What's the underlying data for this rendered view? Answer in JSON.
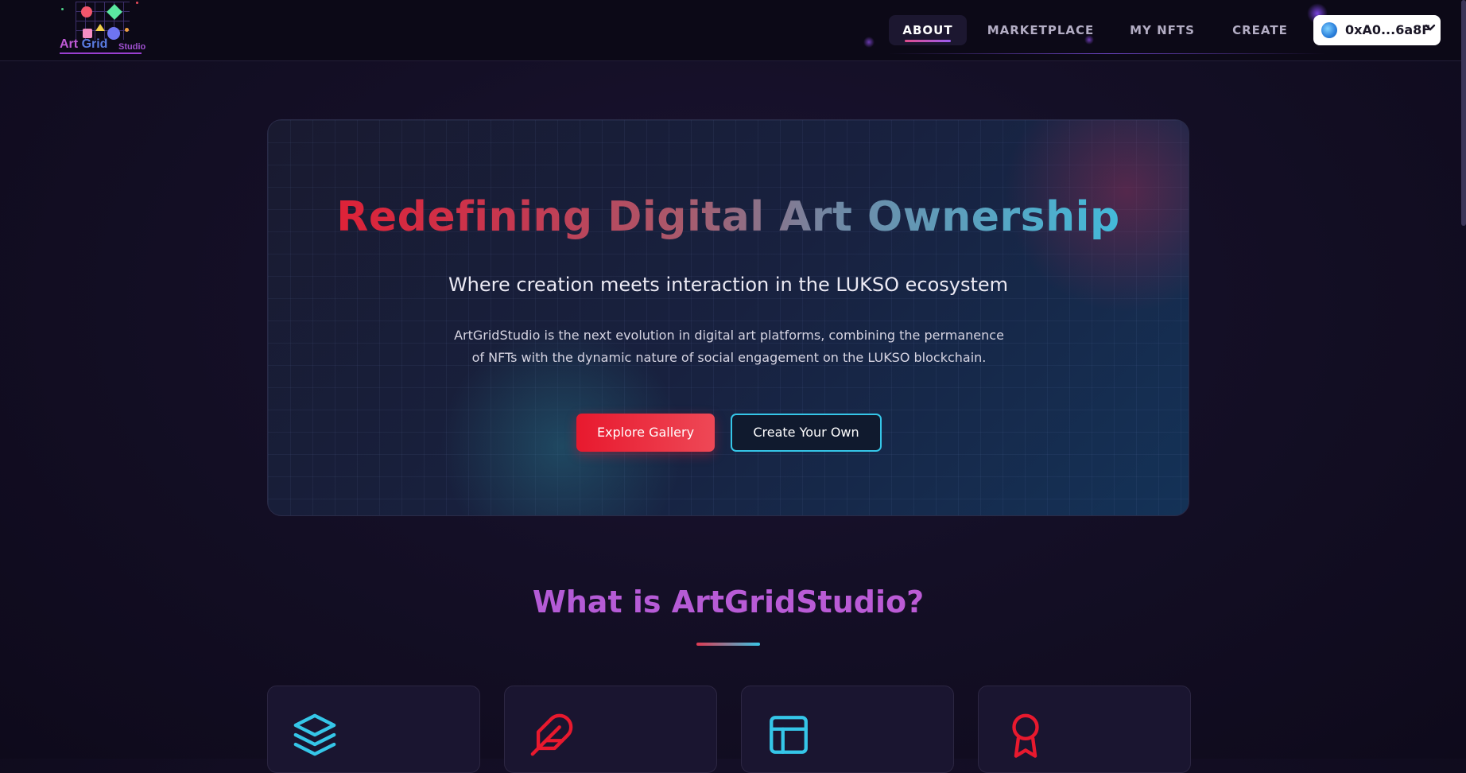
{
  "logo": {
    "word1": "Art",
    "word2": "Grid",
    "word3": "Studio"
  },
  "nav": {
    "items": [
      {
        "label": "ABOUT",
        "active": true
      },
      {
        "label": "MARKETPLACE",
        "active": false
      },
      {
        "label": "MY NFTS",
        "active": false
      },
      {
        "label": "CREATE",
        "active": false
      }
    ]
  },
  "wallet": {
    "address": "0xA0...6a8F",
    "icon": "globe-icon",
    "chevron": "chevron-down-icon"
  },
  "hero": {
    "title": "Redefining Digital Art Ownership",
    "subtitle": "Where creation meets interaction in the LUKSO ecosystem",
    "description": "ArtGridStudio is the next evolution in digital art platforms, combining the permanence of NFTs with the dynamic nature of social engagement on the LUKSO blockchain.",
    "primary_button": "Explore Gallery",
    "secondary_button": "Create Your Own"
  },
  "about": {
    "title": "What is ArtGridStudio?",
    "cards": [
      {
        "icon": "layers-icon",
        "color": "#35c6e8"
      },
      {
        "icon": "feather-icon",
        "color": "#e8192e"
      },
      {
        "icon": "layout-icon",
        "color": "#35c6e8"
      },
      {
        "icon": "award-icon",
        "color": "#e8192e"
      }
    ]
  },
  "colors": {
    "accent_red": "#e8192e",
    "accent_cyan": "#35c6e8",
    "accent_purple": "#a85ad4",
    "background": "#140f26"
  }
}
